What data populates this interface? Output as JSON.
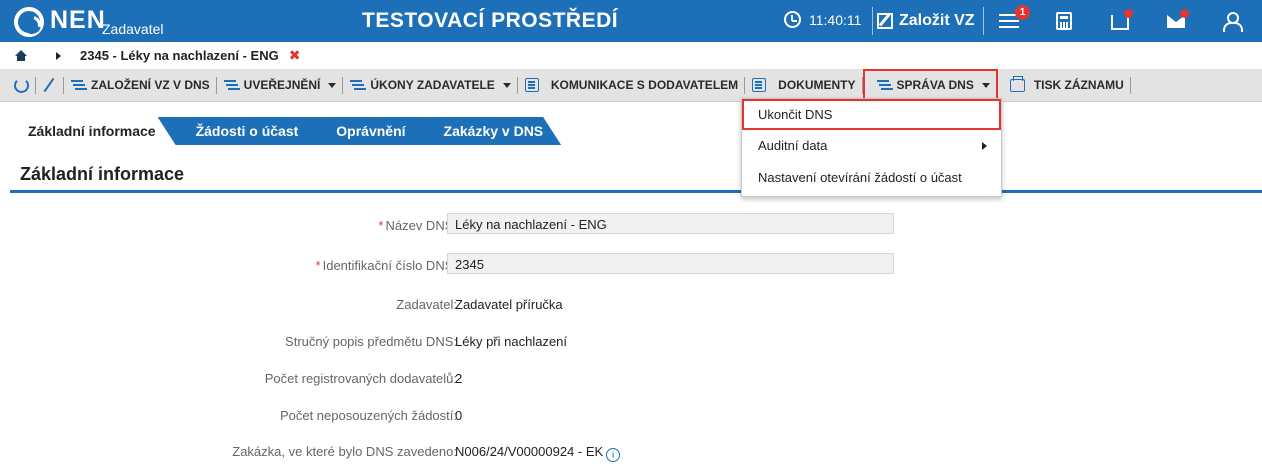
{
  "topbar": {
    "logo_text": "NEN",
    "logo_sub": "Zadavatel",
    "env_title": "TESTOVACÍ PROSTŘEDÍ",
    "time": "11:40:11",
    "create_vz_label": "Založit VZ",
    "notification_count": "1",
    "accent_color": "#1d6fb8"
  },
  "breadcrumb": {
    "current": "2345 - Léky na nachlazení - ENG",
    "close_glyph": "✖"
  },
  "toolbar": {
    "items": [
      {
        "label": "ZALOŽENÍ VZ V DNS"
      },
      {
        "label": "UVEŘEJNĚNÍ"
      },
      {
        "label": "ÚKONY ZADAVATELE"
      },
      {
        "label": "KOMUNIKACE S DODAVATELEM"
      },
      {
        "label": "DOKUMENTY"
      },
      {
        "label": "SPRÁVA DNS"
      },
      {
        "label": "TISK ZÁZNAMU"
      }
    ]
  },
  "tabs": [
    {
      "label": "Základní informace",
      "active": true
    },
    {
      "label": "Žádosti o účast"
    },
    {
      "label": "Oprávnění"
    },
    {
      "label": "Zakázky v DNS"
    }
  ],
  "section": {
    "title": "Základní informace"
  },
  "form": {
    "rows": [
      {
        "label": "Název DNS:",
        "value": "Léky na nachlazení - ENG",
        "required": true
      },
      {
        "label": "Identifikační číslo DNS:",
        "value": "2345",
        "required": true
      },
      {
        "label": "Zadavatel:",
        "value": "Zadavatel příručka"
      },
      {
        "label": "Stručný popis předmětu DNS:",
        "value": "Léky při nachlazení"
      },
      {
        "label": "Počet registrovaných dodavatelů:",
        "value": "2"
      },
      {
        "label": "Počet neposouzených žádostí:",
        "value": "0"
      },
      {
        "label": "Zakázka, ve které bylo DNS zavedeno:",
        "value": "N006/24/V00000924 - EK"
      }
    ]
  },
  "dropdown": {
    "items": [
      {
        "label": "Ukončit DNS",
        "highlighted": true
      },
      {
        "label": "Auditní data",
        "has_submenu": true
      },
      {
        "label": "Nastavení otevírání žádostí o účast"
      }
    ]
  },
  "colors": {
    "primary": "#1d6fb8",
    "highlight": "#e3342f"
  }
}
